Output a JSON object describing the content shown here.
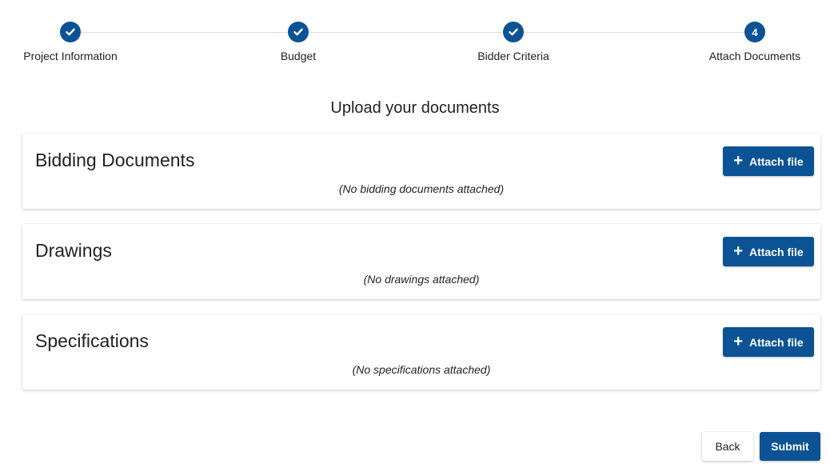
{
  "stepper": {
    "steps": [
      {
        "label": "Project Information",
        "state": "complete"
      },
      {
        "label": "Budget",
        "state": "complete"
      },
      {
        "label": "Bidder Criteria",
        "state": "complete"
      },
      {
        "label": "Attach Documents",
        "state": "current",
        "number": "4"
      }
    ]
  },
  "page": {
    "heading": "Upload your documents"
  },
  "sections": [
    {
      "title": "Bidding Documents",
      "empty_text": "(No bidding documents attached)",
      "button_label": "Attach file"
    },
    {
      "title": "Drawings",
      "empty_text": "(No drawings attached)",
      "button_label": "Attach file"
    },
    {
      "title": "Specifications",
      "empty_text": "(No specifications attached)",
      "button_label": "Attach file"
    }
  ],
  "actions": {
    "back_label": "Back",
    "submit_label": "Submit"
  },
  "colors": {
    "primary": "#0b5394",
    "step_line": "#d9dde3"
  }
}
